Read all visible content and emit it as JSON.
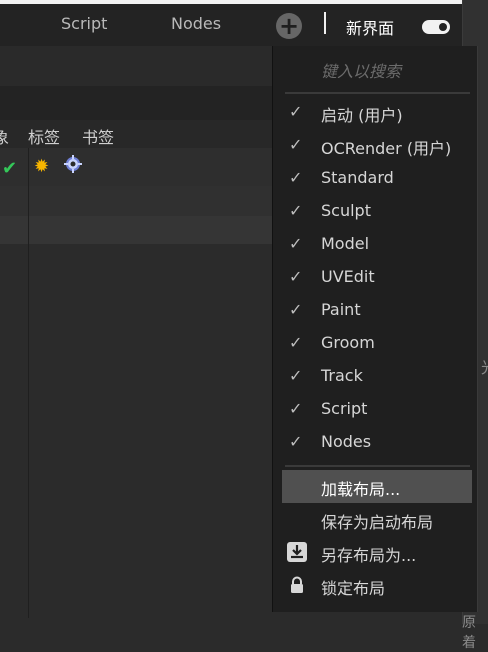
{
  "topbar": {
    "tabs": [
      "Script",
      "Nodes"
    ],
    "add_label": "+",
    "new_ui_label": "新界面"
  },
  "left_panel": {
    "tabs": [
      "象",
      "标签",
      "书签"
    ]
  },
  "menu": {
    "search_placeholder": "键入以搜索",
    "layouts": [
      {
        "label": "启动 (用户)",
        "checked": true
      },
      {
        "label": "OCRender (用户)",
        "checked": true
      },
      {
        "label": "Standard",
        "checked": true
      },
      {
        "label": "Sculpt",
        "checked": true
      },
      {
        "label": "Model",
        "checked": true
      },
      {
        "label": "UVEdit",
        "checked": true
      },
      {
        "label": "Paint",
        "checked": true
      },
      {
        "label": "Groom",
        "checked": true
      },
      {
        "label": "Track",
        "checked": true
      },
      {
        "label": "Script",
        "checked": true
      },
      {
        "label": "Nodes",
        "checked": true
      }
    ],
    "actions": [
      {
        "label": "加载布局..."
      },
      {
        "label": "保存为启动布局"
      },
      {
        "label": "另存布局为..."
      },
      {
        "label": "锁定布局"
      }
    ]
  },
  "right_rail": {
    "text1": "光",
    "text2": "原着"
  }
}
